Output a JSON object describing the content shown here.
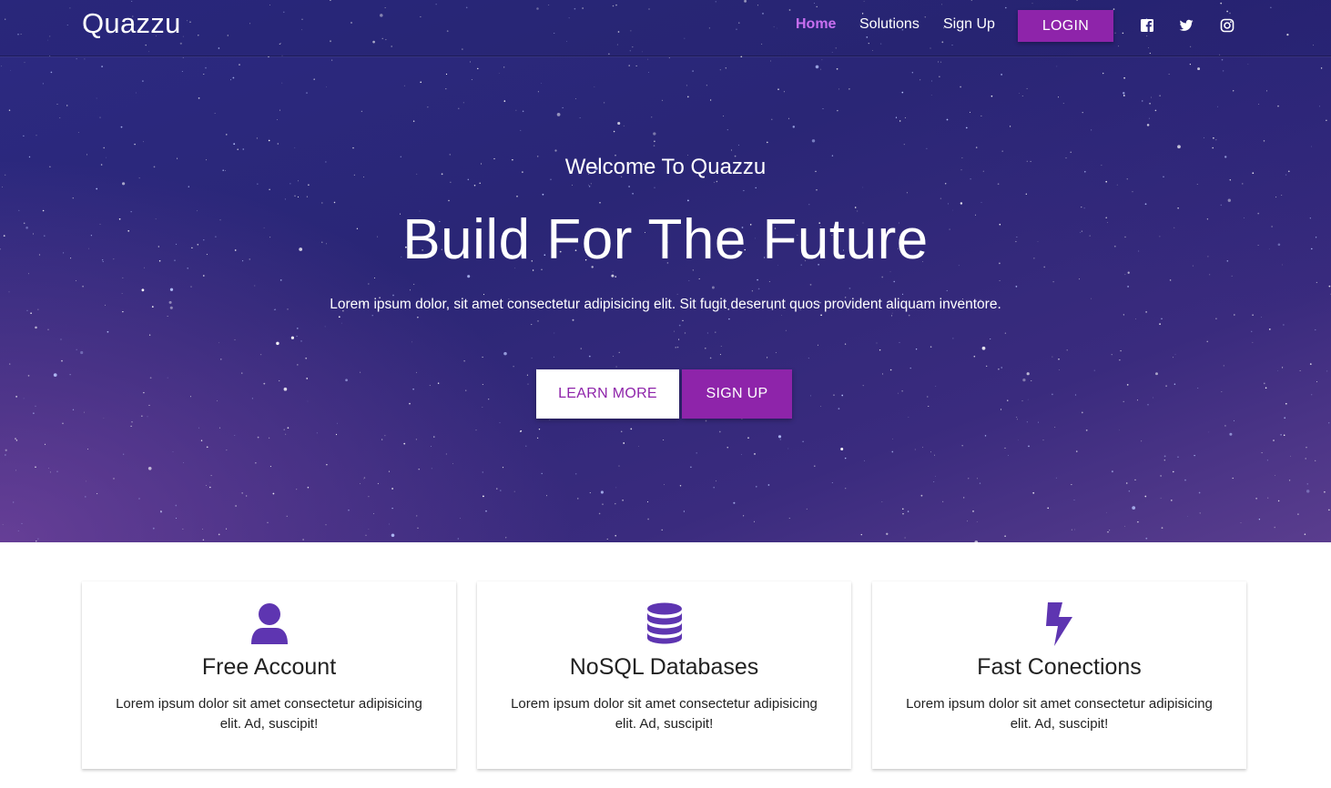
{
  "brand": {
    "name": "Quazzu"
  },
  "nav": {
    "items": [
      {
        "label": "Home",
        "active": true
      },
      {
        "label": "Solutions",
        "active": false
      },
      {
        "label": "Sign Up",
        "active": false
      }
    ],
    "login_label": "LOGIN",
    "social": [
      "facebook-icon",
      "twitter-icon",
      "instagram-icon"
    ]
  },
  "hero": {
    "welcome": "Welcome To Quazzu",
    "headline": "Build For The Future",
    "lead": "Lorem ipsum dolor, sit amet consectetur adipisicing elit. Sit fugit deserunt quos provident aliquam inventore.",
    "learn_more_label": "LEARN MORE",
    "sign_up_label": "SIGN UP"
  },
  "features": [
    {
      "icon": "user-icon",
      "title": "Free Account",
      "text": "Lorem ipsum dolor sit amet consectetur adipisicing elit. Ad, suscipit!"
    },
    {
      "icon": "database-icon",
      "title": "NoSQL Databases",
      "text": "Lorem ipsum dolor sit amet consectetur adipisicing elit. Ad, suscipit!"
    },
    {
      "icon": "bolt-icon",
      "title": "Fast Conections",
      "text": "Lorem ipsum dolor sit amet consectetur adipisicing elit. Ad, suscipit!"
    }
  ],
  "colors": {
    "accent": "#8e24aa",
    "nav_active": "#c86ff0",
    "icon": "#5e35b1",
    "hero_dark": "#2a2676"
  }
}
